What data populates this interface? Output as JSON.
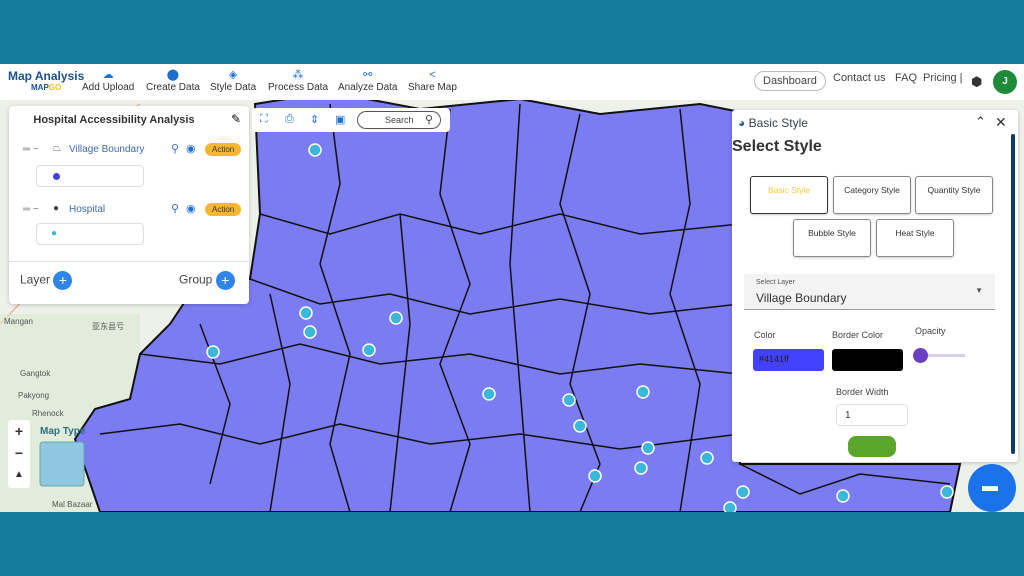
{
  "header": {
    "logo_title": "Map Analysis",
    "logo_sub_a": "MAP",
    "logo_sub_b": "GO",
    "nav": [
      {
        "label": "Add Upload",
        "icon": "cloud-upload-icon"
      },
      {
        "label": "Create Data",
        "icon": "location-pin-icon"
      },
      {
        "label": "Style Data",
        "icon": "paint-bucket-icon"
      },
      {
        "label": "Process Data",
        "icon": "process-icon"
      },
      {
        "label": "Analyze Data",
        "icon": "analyze-icon"
      },
      {
        "label": "Share Map",
        "icon": "share-icon"
      }
    ],
    "dashboard": "Dashboard",
    "contact": "Contact us",
    "faq": "FAQ",
    "pricing": "Pricing |",
    "avatar": "J"
  },
  "layers_panel": {
    "title": "Hospital Accessibility Analysis",
    "layers": [
      {
        "name": "Village Boundary",
        "action": "Action",
        "swatch": "#4141ff"
      },
      {
        "name": "Hospital",
        "action": "Action",
        "swatch": "#3ab7d9"
      }
    ],
    "layer_label": "Layer",
    "group_label": "Group"
  },
  "toolbar": {
    "search_placeholder": "Search"
  },
  "style_panel": {
    "header": "Basic Style",
    "title": "Select Style",
    "styles": [
      "Basic Style",
      "Category Style",
      "Quantity Style",
      "Bubble Style",
      "Heat Style"
    ],
    "active_style": "Basic Style",
    "select_layer_label": "Select Layer",
    "select_layer_value": "Village Boundary",
    "color_label": "Color",
    "color_value": "#4141ff",
    "border_color_label": "Border Color",
    "border_color": "#000000",
    "opacity_label": "Opacity",
    "opacity": 0,
    "border_width_label": "Border Width",
    "border_width": "1"
  },
  "map": {
    "map_type_label": "Map Type",
    "places": [
      "Mangan",
      "亚东县亏",
      "Gangtok",
      "Pakyong",
      "Rhenock",
      "Mal Bazaar"
    ],
    "fill": "#7b7bf2"
  },
  "colors": {
    "frame": "#157a9c",
    "accent": "#1e6fd0",
    "action": "#f5b731",
    "apply": "#5aa52c"
  }
}
